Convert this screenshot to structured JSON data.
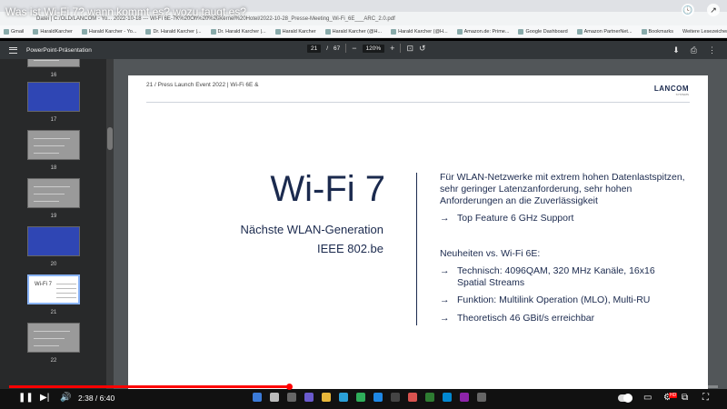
{
  "video": {
    "title": "Was ist Wi-Fi 7? wann kommt es? wozu taugt es?",
    "time_current": "2:38",
    "time_separator": "/",
    "time_total": "6:40",
    "progress_fraction": 0.395,
    "accent_color": "#ff0000"
  },
  "browser": {
    "tab_label": "PowerPoint-Präsentation",
    "url": "Datei | C:/OLD/LANCOM - Yo... 2022-10-18 --- Wi-Fi 6E-7K%20Oh%20%20Kernel%20Hotel/2022-10-28_Presse-Meeting_Wi-Fi_6E___ARC_2.0.pdf",
    "bookmarks": [
      {
        "label": "Gmail",
        "icon": "gmail-icon"
      },
      {
        "label": "HaraldKarcher",
        "icon": "bookmark-icon"
      },
      {
        "label": "Harald Karcher - Yo...",
        "icon": "youtube-icon"
      },
      {
        "label": "Dr. Harald Karcher |...",
        "icon": "bookmark-icon"
      },
      {
        "label": "Dr. Harald Karcher |...",
        "icon": "bookmark-icon"
      },
      {
        "label": "Harald Karcher",
        "icon": "facebook-icon"
      },
      {
        "label": "Harald Karcher (@H...",
        "icon": "twitter-icon"
      },
      {
        "label": "Harald Karcher (@H...",
        "icon": "instagram-icon"
      },
      {
        "label": "Amazon.de: Prime...",
        "icon": "amazon-icon"
      },
      {
        "label": "Google Dashboard",
        "icon": "google-icon"
      },
      {
        "label": "Amazon PartnerNet...",
        "icon": "amazon-icon"
      },
      {
        "label": "Bookmarks",
        "icon": "star-icon"
      }
    ],
    "reading_list": "Weitere Lesezeichen"
  },
  "pdf": {
    "title": "PowerPoint-Präsentation",
    "current_page": "21",
    "page_separator": "/",
    "total_pages": "67",
    "zoom": "120%",
    "zoom_out": "−",
    "zoom_in": "+"
  },
  "thumbnails": [
    {
      "num": "16",
      "style": "gray"
    },
    {
      "num": "17",
      "style": "blue"
    },
    {
      "num": "18",
      "style": "gray"
    },
    {
      "num": "19",
      "style": "gray"
    },
    {
      "num": "20",
      "style": "blue"
    },
    {
      "num": "21",
      "style": "white",
      "selected": true,
      "mini_title": "Wi-Fi 7"
    },
    {
      "num": "22",
      "style": "gray"
    }
  ],
  "slide": {
    "header": "21  /  Press Launch Event 2022 | Wi-Fi 6E &",
    "brand": "LANCOM",
    "brand_sub": "SYSTEMS",
    "title": "Wi-Fi 7",
    "subtitle1": "Nächste WLAN-Generation",
    "subtitle2": "IEEE 802.be",
    "intro": "Für WLAN-Netzwerke mit extrem hohen Datenlastspitzen, sehr geringer Latenzanforderung, sehr hohen Anforderungen an die Zuverlässigkeit",
    "arrow": "→",
    "top_feature": "Top Feature 6 GHz Support",
    "news_heading": "Neuheiten vs. Wi-Fi 6E:",
    "bullets": [
      "Technisch: 4096QAM, 320 MHz Kanäle, 16x16 Spatial Streams",
      "Funktion: Multilink Operation (MLO), Multi-RU",
      "Theoretisch 46 GBit/s erreichbar"
    ]
  }
}
